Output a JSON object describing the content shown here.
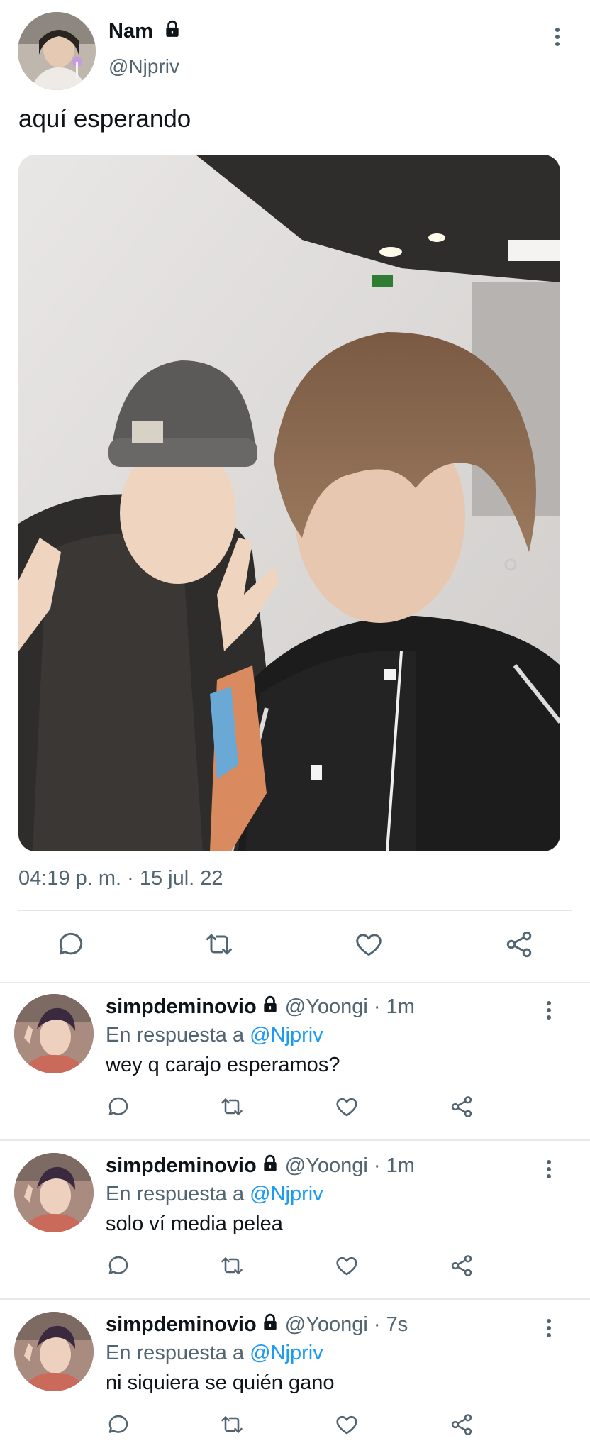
{
  "tweet": {
    "author_name": "Nam",
    "author_handle": "@Njpriv",
    "text": "aquí esperando",
    "timestamp": "04:19 p. m. · 15 jul. 22",
    "locked": true
  },
  "actions": {
    "reply_icon": "reply-bubble-icon",
    "retweet_icon": "retweet-icon",
    "like_icon": "heart-icon",
    "share_icon": "share-icon"
  },
  "replies": [
    {
      "name": "simpdeminovio",
      "handle_time": "@Yoongi · 1m",
      "replying_prefix": "En respuesta a",
      "replying_to": "@Njpriv",
      "text": "wey q carajo esperamos?"
    },
    {
      "name": "simpdeminovio",
      "handle_time": "@Yoongi · 1m",
      "replying_prefix": "En respuesta a",
      "replying_to": "@Njpriv",
      "text": "solo ví media pelea"
    },
    {
      "name": "simpdeminovio",
      "handle_time": "@Yoongi · 7s",
      "replying_prefix": "En respuesta a",
      "replying_to": "@Njpriv",
      "text": "ni siquiera se quién gano"
    }
  ],
  "colors": {
    "text_primary": "#0f1419",
    "text_secondary": "#536471",
    "link": "#1d9bf0",
    "divider": "#e7e9eb"
  }
}
